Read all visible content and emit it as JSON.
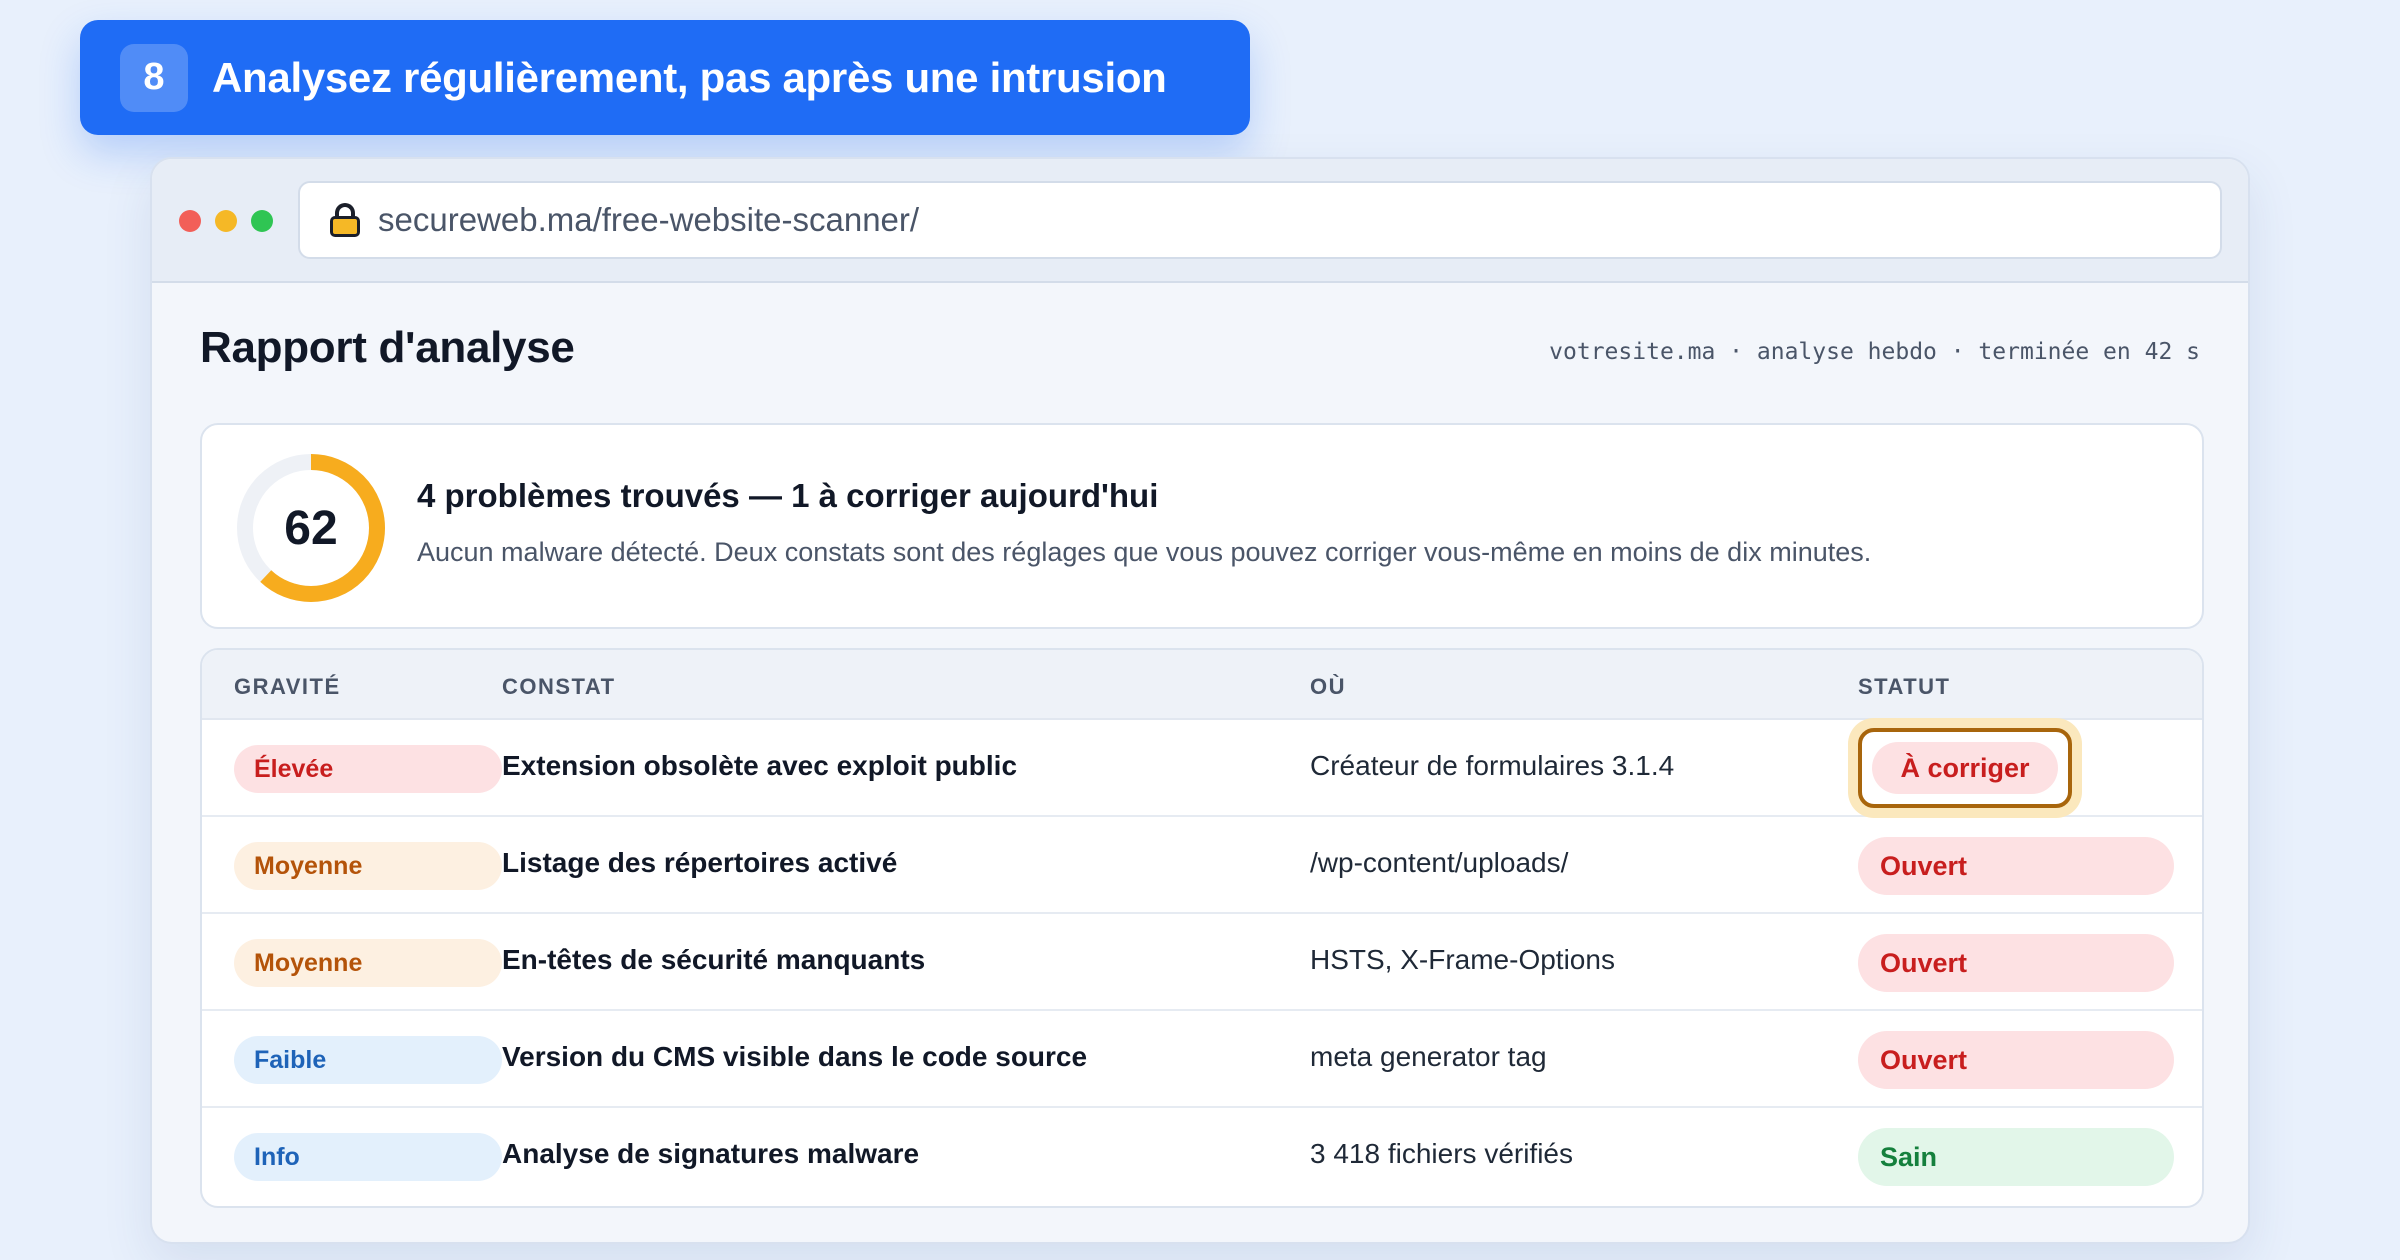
{
  "step": {
    "number": "8",
    "title": "Analysez régulièrement, pas après une intrusion"
  },
  "browser": {
    "url": "secureweb.ma/free-website-scanner/"
  },
  "report": {
    "title": "Rapport d'analyse",
    "meta": "votresite.ma · analyse hebdo · terminée en 42 s"
  },
  "summary": {
    "score": "62",
    "score_fraction": 0.62,
    "headline": "4 problèmes trouvés — 1 à corriger aujourd'hui",
    "detail": "Aucun malware détecté. Deux constats sont des réglages que vous pouvez corriger vous-même en moins de dix minutes."
  },
  "table": {
    "headers": {
      "severity": "GRAVITÉ",
      "finding": "CONSTAT",
      "where": "OÙ",
      "status": "STATUT"
    },
    "rows": [
      {
        "severity": "Élevée",
        "finding": "Extension obsolète avec exploit public",
        "where": "Créateur de formulaires 3.1.4",
        "status": "À corriger"
      },
      {
        "severity": "Moyenne",
        "finding": "Listage des répertoires activé",
        "where": "/wp-content/uploads/",
        "status": "Ouvert"
      },
      {
        "severity": "Moyenne",
        "finding": "En-têtes de sécurité manquants",
        "where": "HSTS, X-Frame-Options",
        "status": "Ouvert"
      },
      {
        "severity": "Faible",
        "finding": "Version du CMS visible dans le code source",
        "where": "meta generator tag",
        "status": "Ouvert"
      },
      {
        "severity": "Info",
        "finding": "Analyse de signatures malware",
        "where": "3 418 fichiers vérifiés",
        "status": "Sain"
      }
    ]
  },
  "colors": {
    "accent": "#1f6cf5",
    "score_ring": "#f7ac1e",
    "score_track": "#eef1f6",
    "severity_high": "#c81e1e",
    "severity_medium": "#b45309",
    "severity_low": "#1e63b8",
    "status_open": "#c81e1e",
    "status_clean": "#15803d"
  },
  "icons": {
    "url_lock": "lock-icon"
  }
}
